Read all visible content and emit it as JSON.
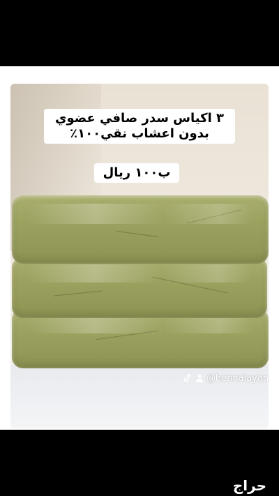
{
  "post": {
    "caption_lines": [
      "٣ اكياس سدر صافي عضوي",
      "بدون اعشاب نقي١٠٠٪"
    ],
    "price": "ب١٠٠ ريال",
    "watermark_handle": "@hennalayan"
  },
  "footer": {
    "logo_text": "حراج"
  },
  "icons": [
    "tiktok-logo-icon",
    "person-icon"
  ],
  "colors": {
    "background": "#000000",
    "frame": "#ffffff",
    "bag_green": "#9ba15e"
  }
}
